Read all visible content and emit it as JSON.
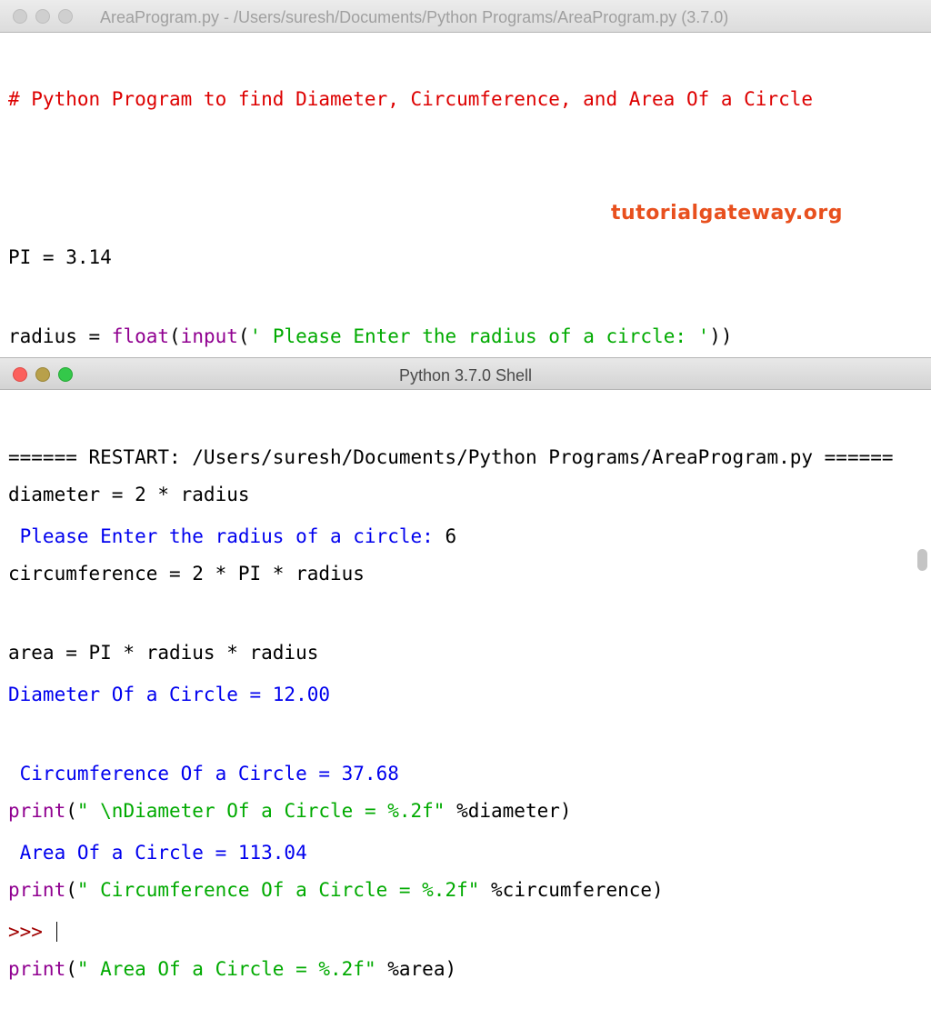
{
  "editor": {
    "title": "AreaProgram.py - /Users/suresh/Documents/Python Programs/AreaProgram.py (3.7.0)",
    "lines": {
      "l1": "# Python Program to find Diameter, Circumference, and Area Of a Circle",
      "l3": "PI = 3.14",
      "l4_a": "radius = ",
      "l4_float": "float",
      "l4_b": "(",
      "l4_input": "input",
      "l4_c": "(",
      "l4_str": "' Please Enter the radius of a circle: '",
      "l4_d": "))",
      "l6": "diameter = 2 * radius",
      "l7": "circumference = 2 * PI * radius",
      "l8": "area = PI * radius * radius",
      "print": "print",
      "l10_a": "(",
      "l10_str": "\" \\nDiameter Of a Circle = %.2f\"",
      "l10_b": " %diameter)",
      "l11_a": "(",
      "l11_str": "\" Circumference Of a Circle = %.2f\"",
      "l11_b": " %circumference)",
      "l12_a": "(",
      "l12_str": "\" Area Of a Circle = %.2f\"",
      "l12_b": " %area)"
    },
    "watermark": "tutorialgateway.org"
  },
  "shell": {
    "title": "Python 3.7.0 Shell",
    "restart": "====== RESTART: /Users/suresh/Documents/Python Programs/AreaProgram.py ======",
    "prompt_text": " Please Enter the radius of a circle: ",
    "input_value": "6",
    "out1": "Diameter Of a Circle = 12.00",
    "out2": " Circumference Of a Circle = 37.68",
    "out3": " Area Of a Circle = 113.04",
    "repl_prompt": ">>> "
  },
  "colors": {
    "comment": "#dd0000",
    "builtin": "#900090",
    "string": "#00aa00",
    "output": "#0000ee",
    "brand": "#e8501e"
  }
}
